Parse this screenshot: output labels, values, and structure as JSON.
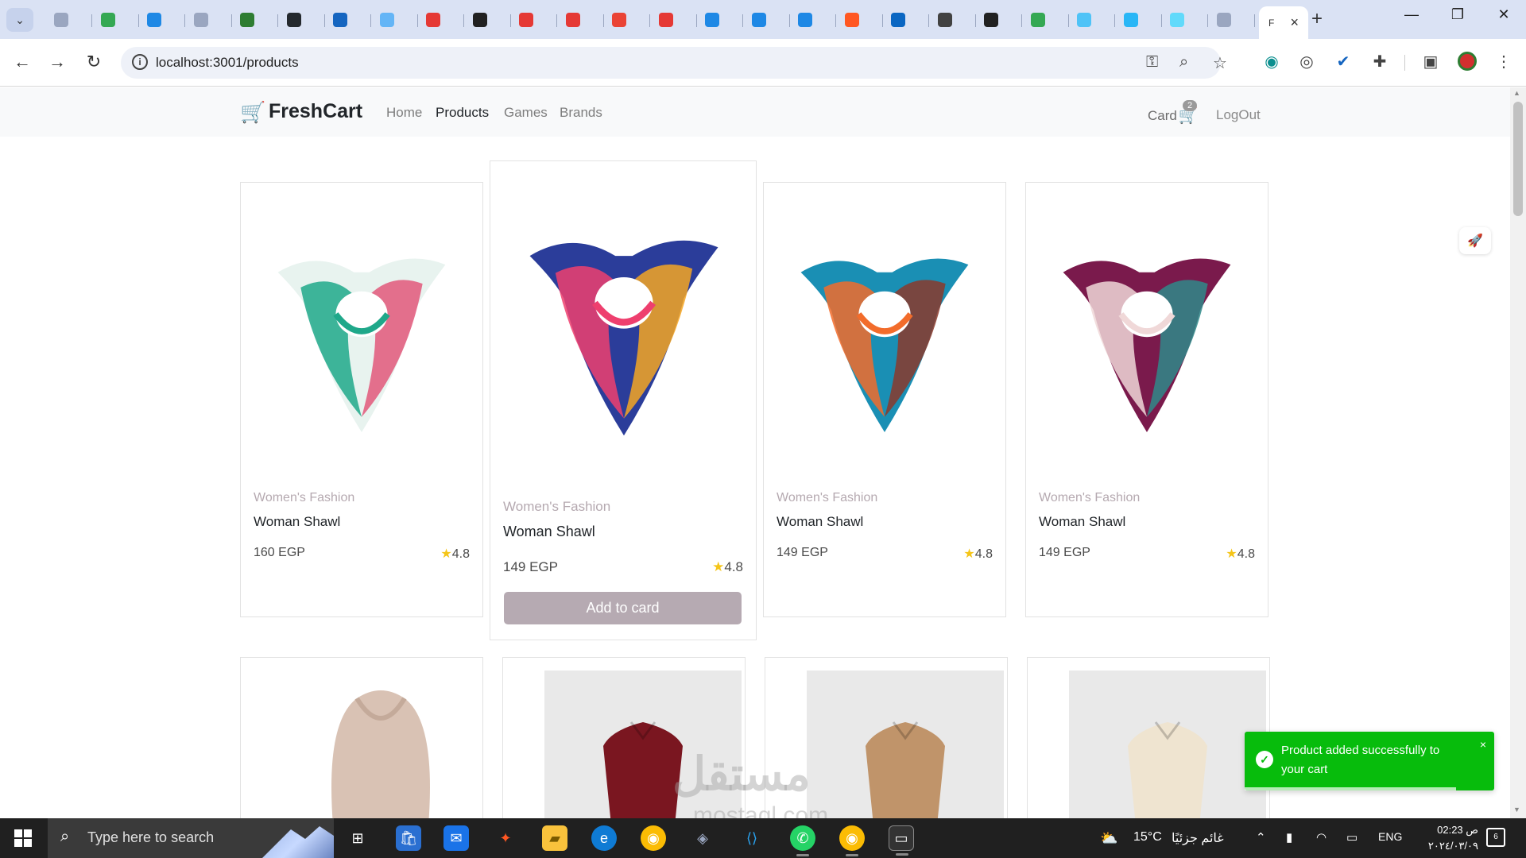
{
  "browser": {
    "url": "localhost:3001/products",
    "tab_favicon_colors": [
      "#9aa6c0",
      "#34a853",
      "#1e88e5",
      "#9aa6c0",
      "#2e7d32",
      "#24292e",
      "#1565c0",
      "#64b5f6",
      "#e53935",
      "#212121",
      "#e53935",
      "#e53935",
      "#ea4335",
      "#e53935",
      "#1e88e5",
      "#1e88e5",
      "#1e88e5",
      "#ff5722",
      "#0a66c2",
      "#424242",
      "#212121",
      "#34a853",
      "#4fc3f7",
      "#29b6f6",
      "#61dafb",
      "#9aa6c0"
    ],
    "active_tab_label": "F"
  },
  "navbar": {
    "brand": "FreshCart",
    "links": [
      "Home",
      "Products",
      "Games",
      "Brands"
    ],
    "card_label": "Card",
    "cart_count": "2",
    "logout": "LogOut"
  },
  "products_row1": [
    {
      "category": "Women's Fashion",
      "name": "Woman Shawl",
      "price": "160 EGP",
      "rating": "4.8",
      "colors": [
        "#e8f3ef",
        "#1fa88a",
        "#e2577a"
      ]
    },
    {
      "category": "Women's Fashion",
      "name": "Woman Shawl",
      "price": "149 EGP",
      "rating": "4.8",
      "colors": [
        "#2b3d9a",
        "#ee3f6e",
        "#f5a623"
      ],
      "button": "Add to card"
    },
    {
      "category": "Women's Fashion",
      "name": "Woman Shawl",
      "price": "149 EGP",
      "rating": "4.8",
      "colors": [
        "#1a8fb4",
        "#f26c2b",
        "#8b3a2b"
      ]
    },
    {
      "category": "Women's Fashion",
      "name": "Woman Shawl",
      "price": "149 EGP",
      "rating": "4.8",
      "colors": [
        "#7a1a4c",
        "#f0d8d8",
        "#2f8a8a"
      ]
    }
  ],
  "products_row2": [
    {
      "colors": [
        "#d9c2b4"
      ]
    },
    {
      "colors": [
        "#7a1620"
      ]
    },
    {
      "colors": [
        "#c0946a"
      ]
    },
    {
      "colors": [
        "#efe4d0"
      ]
    }
  ],
  "toast": {
    "message": "Product added successfully to your cart",
    "close": "×"
  },
  "watermark": {
    "arabic": "مستقل",
    "latin": "mostaql.com"
  },
  "taskbar": {
    "search_placeholder": "Type here to search",
    "weather": "15°C",
    "weather_text": "غائم جزئيًا",
    "lang": "ENG",
    "time": "02:23 ص",
    "date": "٢٠٢٤/٠٣/٠٩",
    "notif_count": "6"
  }
}
